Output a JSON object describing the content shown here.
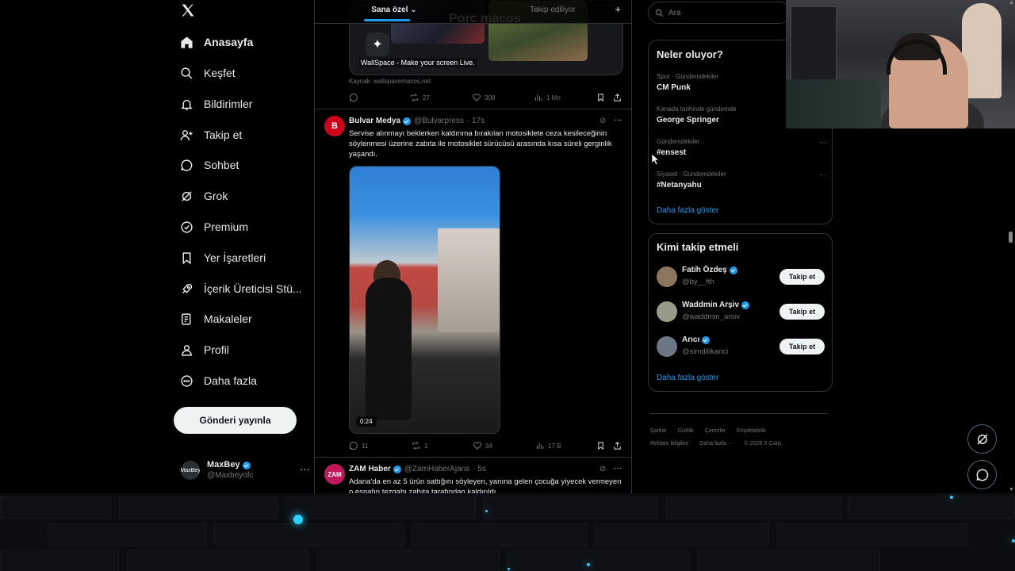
{
  "nav": {
    "items": [
      {
        "label": "Anasayfa",
        "icon": "home-icon",
        "active": true
      },
      {
        "label": "Keşfet",
        "icon": "search-icon"
      },
      {
        "label": "Bildirimler",
        "icon": "bell-icon"
      },
      {
        "label": "Takip et",
        "icon": "person-add-icon"
      },
      {
        "label": "Sohbet",
        "icon": "chat-icon"
      },
      {
        "label": "Grok",
        "icon": "grok-icon"
      },
      {
        "label": "Premium",
        "icon": "premium-icon"
      },
      {
        "label": "Yer İşaretleri",
        "icon": "bookmark-icon"
      },
      {
        "label": "İçerik Üreticisi Stü...",
        "icon": "rocket-icon"
      },
      {
        "label": "Makaleler",
        "icon": "article-icon"
      },
      {
        "label": "Profil",
        "icon": "profile-icon"
      },
      {
        "label": "Daha fazla",
        "icon": "more-circle-icon"
      }
    ],
    "post_button": "Gönderi yayınla",
    "account": {
      "name": "MaxBey",
      "handle": "@Maxbeyofc",
      "avatar_text": "MaxBey"
    }
  },
  "feed": {
    "tabs": [
      {
        "label": "Sana özel",
        "active": true
      },
      {
        "label": "Takip ediliyor"
      }
    ],
    "prev_card": {
      "big_text": "Porc macos",
      "caption": "WallSpace - Make your screen Live.",
      "source": "Kaynak: wallspacemacos.net",
      "actions": {
        "replies": "",
        "reposts": "27",
        "likes": "308",
        "views": "1 Mn"
      }
    },
    "tweets": [
      {
        "name": "Bulvar Medya",
        "handle": "@Bulvarpress",
        "time": "· 17s",
        "avatar_text": "B",
        "avatar_color": "#d0021b",
        "text": "Servise alınmayı beklerken kaldırıma bırakılan motosiklete ceza kesileceğinin söylenmesi üzerine zabıta ile motosiklet sürücüsü arasında kısa süreli gerginlik yaşandı.",
        "video_duration": "0:24",
        "actions": {
          "replies": "11",
          "reposts": "1",
          "likes": "34",
          "views": "17 B"
        }
      },
      {
        "name": "ZAM Haber",
        "handle": "@ZamHaberAjans",
        "time": "· 5s",
        "avatar_text": "ZAM",
        "avatar_color": "#c2185b",
        "text": "Adana'da en az 5 ürün sattığını söyleyen, yanına gelen çocuğa yiyecek vermeyen o esnafın tezgahı zabıta tarafından kaldırıldı."
      }
    ]
  },
  "sidebar": {
    "search_placeholder": "Ara",
    "trends_title": "Neler oluyor?",
    "trends": [
      {
        "meta": "Spor · Gündemdekiler",
        "name": "CM Punk"
      },
      {
        "meta": "Kanada tarihinde gündemde",
        "name": "George Springer"
      },
      {
        "meta": "Gündemdekiler",
        "name": "#ensest"
      },
      {
        "meta": "Siyaset · Gündemdekiler",
        "name": "#Netanyahu"
      }
    ],
    "trends_more": "Daha fazla göster",
    "who_title": "Kimi takip etmeli",
    "who": [
      {
        "name": "Fatih Özdeş",
        "handle": "@by__fth",
        "avatar_color": "#8a7560"
      },
      {
        "name": "Waddmin Arşiv",
        "handle": "@waddmin_arsiv",
        "avatar_color": "#9a9a8a"
      },
      {
        "name": "Arıcı",
        "handle": "@simdilikarici",
        "avatar_color": "#6d7784"
      }
    ],
    "follow_label": "Takip et",
    "who_more": "Daha fazla göster",
    "footer": [
      "Şartlar",
      "Gizlilik",
      "Çerezler",
      "Erişilebilirlik",
      "Reklam Bilgileri",
      "Daha fazla ···",
      "© 2026 X Corp."
    ]
  },
  "colors": {
    "accent": "#1d9bf0",
    "background": "#000000",
    "border": "#2f3336",
    "muted": "#71767b"
  }
}
